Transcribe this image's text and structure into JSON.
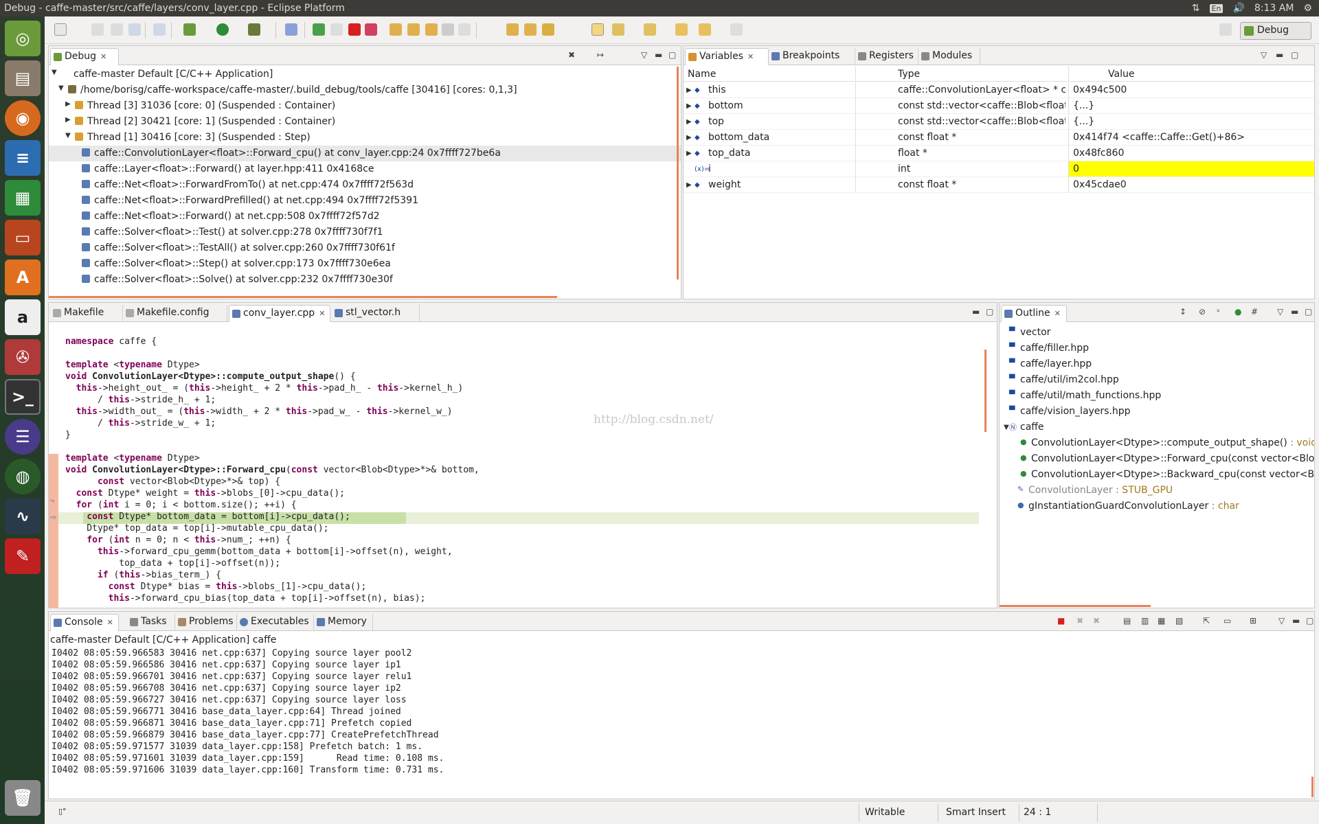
{
  "window": {
    "title": "Debug - caffe-master/src/caffe/layers/conv_layer.cpp - Eclipse Platform"
  },
  "tray": {
    "lang": "En",
    "time": "8:13 AM"
  },
  "launcher": {
    "items": [
      "dash-icon",
      "files-icon",
      "firefox-icon",
      "writer-icon",
      "calc-icon",
      "impress-icon",
      "software-center-icon",
      "amazon-icon",
      "settings-icon",
      "terminal-icon",
      "eclipse-icon",
      "network-icon",
      "system-monitor-icon",
      "pdf-icon",
      "trash-icon"
    ]
  },
  "perspective": {
    "label": "Debug"
  },
  "debug": {
    "tab": "Debug",
    "app": "caffe-master Default [C/C++ Application]",
    "process": "/home/borisg/caffe-workspace/caffe-master/.build_debug/tools/caffe [30416] [cores: 0,1,3]",
    "threads": [
      "Thread [3] 31036 [core: 0] (Suspended : Container)",
      "Thread [2] 30421 [core: 1] (Suspended : Container)",
      "Thread [1] 30416 [core: 3] (Suspended : Step)"
    ],
    "frames": [
      "caffe::ConvolutionLayer<float>::Forward_cpu() at conv_layer.cpp:24 0x7ffff727be6a",
      "caffe::Layer<float>::Forward() at layer.hpp:411 0x4168ce",
      "caffe::Net<float>::ForwardFromTo() at net.cpp:474 0x7ffff72f563d",
      "caffe::Net<float>::ForwardPrefilled() at net.cpp:494 0x7ffff72f5391",
      "caffe::Net<float>::Forward() at net.cpp:508 0x7ffff72f57d2",
      "caffe::Solver<float>::Test() at solver.cpp:278 0x7ffff730f7f1",
      "caffe::Solver<float>::TestAll() at solver.cpp:260 0x7ffff730f61f",
      "caffe::Solver<float>::Step() at solver.cpp:173 0x7ffff730e6ea",
      "caffe::Solver<float>::Solve() at solver.cpp:232 0x7ffff730e30f"
    ]
  },
  "variables": {
    "tabs": [
      "Variables",
      "Breakpoints",
      "Registers",
      "Modules"
    ],
    "headers": [
      "Name",
      "Type",
      "Value"
    ],
    "rows": [
      {
        "name": "this",
        "type": "caffe::ConvolutionLayer<float> * const",
        "value": "0x494c500"
      },
      {
        "name": "bottom",
        "type": "const std::vector<caffe::Blob<float>*, std::al",
        "value": "{...}"
      },
      {
        "name": "top",
        "type": "const std::vector<caffe::Blob<float>*, std::al",
        "value": "{...}"
      },
      {
        "name": "bottom_data",
        "type": "const float *",
        "value": "0x414f74 <caffe::Caffe::Get()+86>"
      },
      {
        "name": "top_data",
        "type": "float *",
        "value": "0x48fc860"
      },
      {
        "name": "i",
        "type": "int",
        "value": "0"
      },
      {
        "name": "weight",
        "type": "const float *",
        "value": "0x45cdae0"
      }
    ],
    "highlight_color": "#ffff00"
  },
  "editor": {
    "tabs": [
      "Makefile",
      "Makefile.config",
      "conv_layer.cpp",
      "stl_vector.h"
    ],
    "watermark": "http://blog.csdn.net/",
    "lines": [
      "namespace caffe {",
      "",
      "template <typename Dtype>",
      "void ConvolutionLayer<Dtype>::compute_output_shape() {",
      "  this->height_out_ = (this->height_ + 2 * this->pad_h_ - this->kernel_h_)",
      "      / this->stride_h_ + 1;",
      "  this->width_out_ = (this->width_ + 2 * this->pad_w_ - this->kernel_w_)",
      "      / this->stride_w_ + 1;",
      "}",
      "",
      "template <typename Dtype>",
      "void ConvolutionLayer<Dtype>::Forward_cpu(const vector<Blob<Dtype>*>& bottom,",
      "      const vector<Blob<Dtype>*>& top) {",
      "  const Dtype* weight = this->blobs_[0]->cpu_data();",
      "  for (int i = 0; i < bottom.size(); ++i) {",
      "    const Dtype* bottom_data = bottom[i]->cpu_data();",
      "    Dtype* top_data = top[i]->mutable_cpu_data();",
      "    for (int n = 0; n < this->num_; ++n) {",
      "      this->forward_cpu_gemm(bottom_data + bottom[i]->offset(n), weight,",
      "          top_data + top[i]->offset(n));",
      "      if (this->bias_term_) {",
      "        const Dtype* bias = this->blobs_[1]->cpu_data();",
      "        this->forward_cpu_bias(top_data + top[i]->offset(n), bias);"
    ]
  },
  "outline": {
    "tab": "Outline",
    "items": [
      {
        "label": "vector",
        "suffix": ""
      },
      {
        "label": "caffe/filler.hpp",
        "suffix": ""
      },
      {
        "label": "caffe/layer.hpp",
        "suffix": ""
      },
      {
        "label": "caffe/util/im2col.hpp",
        "suffix": ""
      },
      {
        "label": "caffe/util/math_functions.hpp",
        "suffix": ""
      },
      {
        "label": "caffe/vision_layers.hpp",
        "suffix": ""
      },
      {
        "label": "caffe",
        "suffix": ""
      },
      {
        "label": "ConvolutionLayer<Dtype>::compute_output_shape()",
        "suffix": " : void"
      },
      {
        "label": "ConvolutionLayer<Dtype>::Forward_cpu(const vector<Blob<D",
        "suffix": ""
      },
      {
        "label": "ConvolutionLayer<Dtype>::Backward_cpu(const vector<Blob",
        "suffix": ""
      },
      {
        "label": "ConvolutionLayer",
        "suffix": " : STUB_GPU"
      },
      {
        "label": "gInstantiationGuardConvolutionLayer",
        "suffix": " : char"
      }
    ]
  },
  "console": {
    "tabs": [
      "Console",
      "Tasks",
      "Problems",
      "Executables",
      "Memory"
    ],
    "title": "caffe-master Default [C/C++ Application] caffe",
    "lines": [
      "I0402 08:05:59.966583 30416 net.cpp:637] Copying source layer pool2",
      "I0402 08:05:59.966586 30416 net.cpp:637] Copying source layer ip1",
      "I0402 08:05:59.966701 30416 net.cpp:637] Copying source layer relu1",
      "I0402 08:05:59.966708 30416 net.cpp:637] Copying source layer ip2",
      "I0402 08:05:59.966727 30416 net.cpp:637] Copying source layer loss",
      "I0402 08:05:59.966771 30416 base_data_layer.cpp:64] Thread joined",
      "I0402 08:05:59.966871 30416 base_data_layer.cpp:71] Prefetch copied",
      "I0402 08:05:59.966879 30416 base_data_layer.cpp:77] CreatePrefetchThread",
      "I0402 08:05:59.971577 31039 data_layer.cpp:158] Prefetch batch: 1 ms.",
      "I0402 08:05:59.971601 31039 data_layer.cpp:159]      Read time: 0.108 ms.",
      "I0402 08:05:59.971606 31039 data_layer.cpp:160] Transform time: 0.731 ms."
    ]
  },
  "status": {
    "writable": "Writable",
    "insert": "Smart Insert",
    "position": "24 : 1"
  }
}
